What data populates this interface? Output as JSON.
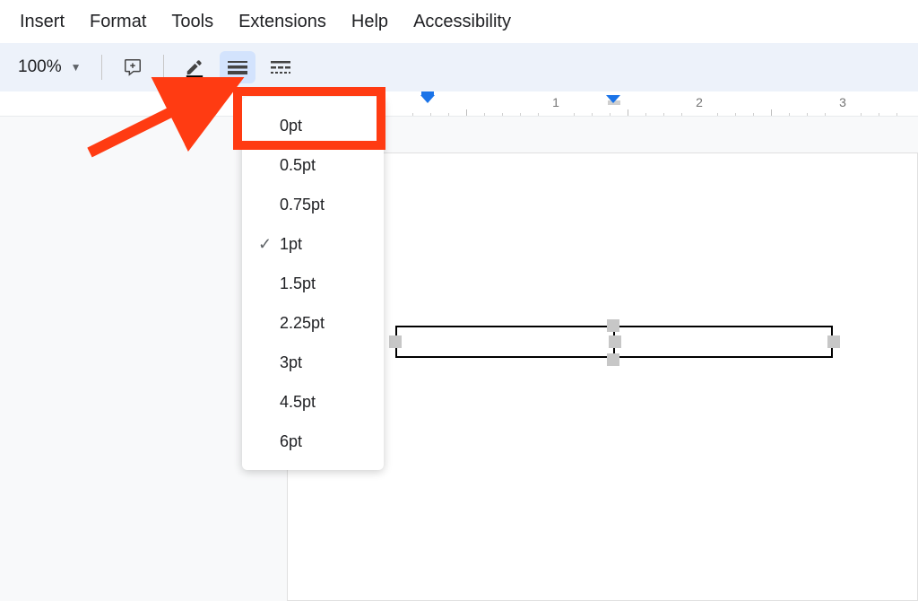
{
  "menubar": {
    "items": [
      "Insert",
      "Format",
      "Tools",
      "Extensions",
      "Help",
      "Accessibility"
    ]
  },
  "toolbar": {
    "zoom": "100%"
  },
  "ruler": {
    "numbers": [
      1,
      2,
      3
    ]
  },
  "border_width_menu": {
    "items": [
      "0pt",
      "0.5pt",
      "0.75pt",
      "1pt",
      "1.5pt",
      "2.25pt",
      "3pt",
      "4.5pt",
      "6pt"
    ],
    "selected": "1pt",
    "highlighted": "0pt"
  }
}
